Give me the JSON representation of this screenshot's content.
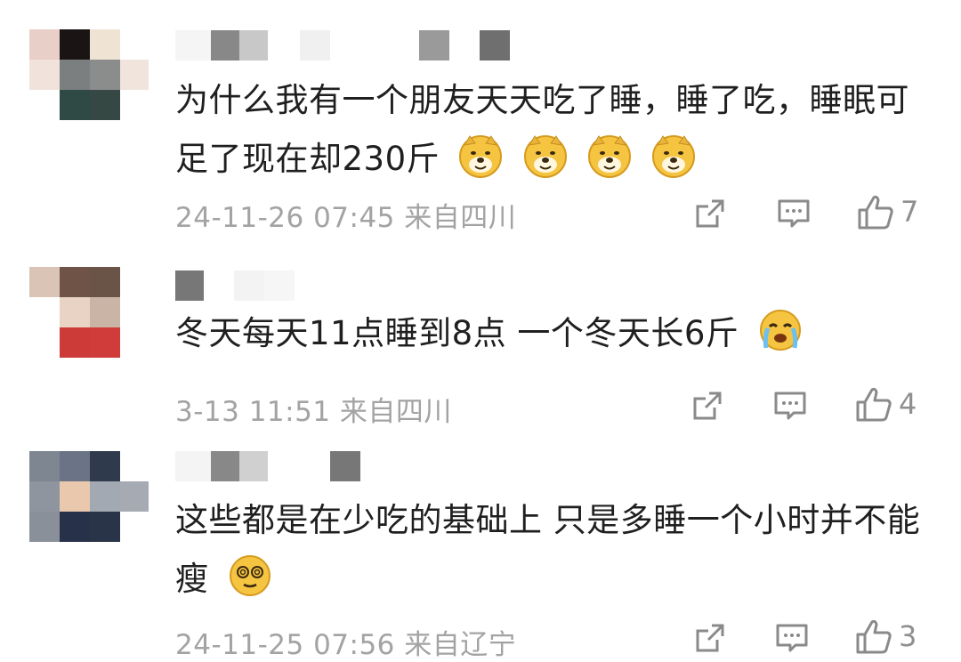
{
  "comments": [
    {
      "text": "为什么我有一个朋友天天吃了睡，睡了吃，睡眠可足了现在却230斤",
      "emojis": [
        "doge-emoji",
        "doge-emoji",
        "doge-emoji",
        "doge-emoji"
      ],
      "meta": "24-11-26 07:45 来自四川",
      "likes": "7"
    },
    {
      "text": "冬天每天11点睡到8点 一个冬天长6斤",
      "emojis": [
        "crying-emoji"
      ],
      "meta": "3-13 11:51 来自四川",
      "likes": "4"
    },
    {
      "text": "这些都是在少吃的基础上 只是多睡一个小时并不能瘦",
      "emojis": [
        "spiral-eyes-emoji"
      ],
      "meta": "24-11-25 07:56 来自辽宁",
      "likes": "3"
    }
  ],
  "colors": {
    "text": "#1f1f1f",
    "meta": "#a3a3a3",
    "icon": "#8a8a8a",
    "emoji": "#f5c542"
  }
}
